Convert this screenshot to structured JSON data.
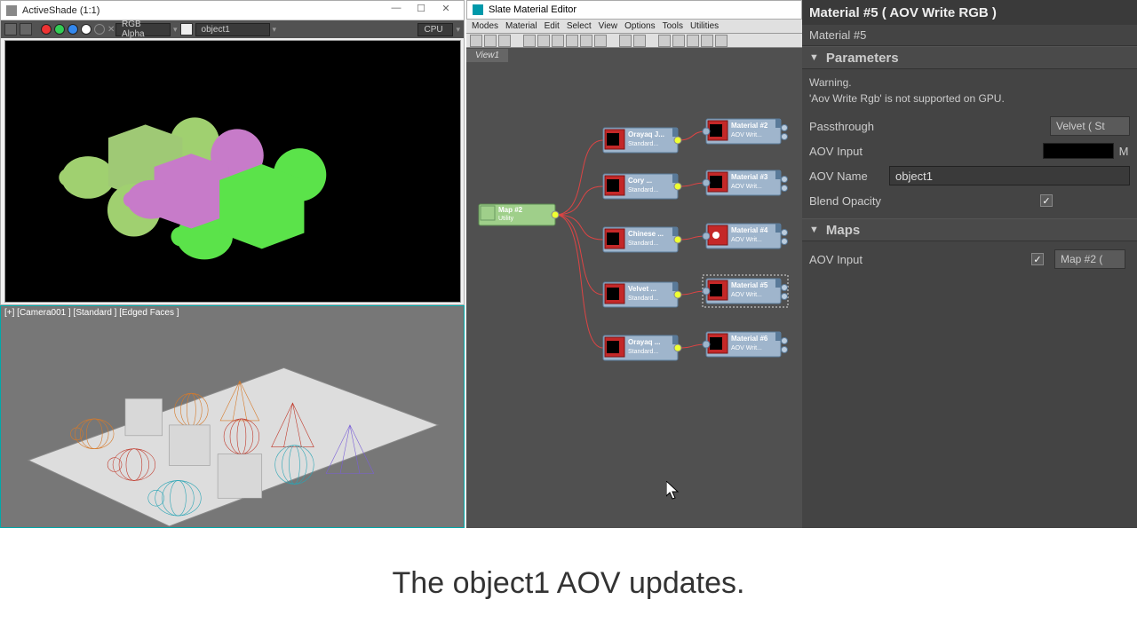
{
  "activeShade": {
    "title": "ActiveShade (1:1)",
    "alphaMode": "RGB Alpha",
    "aovSelect": "object1",
    "device": "CPU"
  },
  "viewport": {
    "label": "[+] [Camera001 ] [Standard ] [Edged Faces ]"
  },
  "slate": {
    "title": "Slate Material Editor",
    "menu": [
      "Modes",
      "Material",
      "Edit",
      "Select",
      "View",
      "Options",
      "Tools",
      "Utilities"
    ],
    "tab": "View1",
    "mapNode": {
      "title": "Map #2",
      "sub": "Utility"
    },
    "midNodes": [
      {
        "title": "Orayaq J...",
        "sub": "Standard..."
      },
      {
        "title": "Cory ...",
        "sub": "Standard..."
      },
      {
        "title": "Chinese ...",
        "sub": "Standard..."
      },
      {
        "title": "Velvet ...",
        "sub": "Standard..."
      },
      {
        "title": "Orayaq ...",
        "sub": "Standard..."
      }
    ],
    "matNodes": [
      {
        "title": "Material #2",
        "sub": "AOV Writ..."
      },
      {
        "title": "Material #3",
        "sub": "AOV Writ..."
      },
      {
        "title": "Material #4",
        "sub": "AOV Writ..."
      },
      {
        "title": "Material #5",
        "sub": "AOV Writ..."
      },
      {
        "title": "Material #6",
        "sub": "AOV Writ..."
      }
    ]
  },
  "panel": {
    "title": "Material #5  ( AOV Write RGB )",
    "subtitle": "Material #5",
    "sections": {
      "params": "Parameters",
      "maps": "Maps"
    },
    "warning1": "Warning.",
    "warning2": "'Aov Write Rgb' is not supported on GPU.",
    "labels": {
      "passthrough": "Passthrough",
      "aovInput": "AOV Input",
      "aovName": "AOV Name",
      "blendOpacity": "Blend Opacity",
      "mapsAovInput": "AOV Input"
    },
    "values": {
      "passthrough": "Velvet  ( St",
      "aovName": "object1",
      "mapsAov": "Map #2  ("
    }
  },
  "caption": "The object1 AOV updates."
}
